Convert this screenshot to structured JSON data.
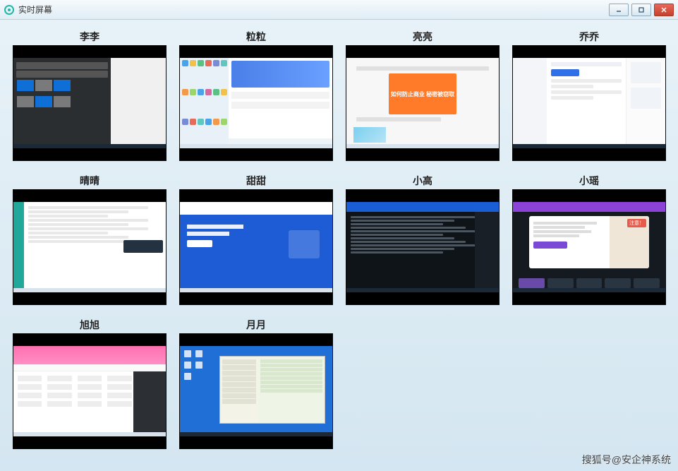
{
  "window": {
    "title": "实时屏幕"
  },
  "users": [
    {
      "name": "李李"
    },
    {
      "name": "粒粒"
    },
    {
      "name": "亮亮"
    },
    {
      "name": "乔乔"
    },
    {
      "name": "晴晴"
    },
    {
      "name": "甜甜"
    },
    {
      "name": "小高"
    },
    {
      "name": "小瑶"
    },
    {
      "name": "旭旭"
    },
    {
      "name": "月月"
    }
  ],
  "thumb_texts": {
    "liang_card": "如何防止商业\n秘密被窃取",
    "yao_badge": "注意！"
  },
  "watermark": "搜狐号@安企神系统"
}
